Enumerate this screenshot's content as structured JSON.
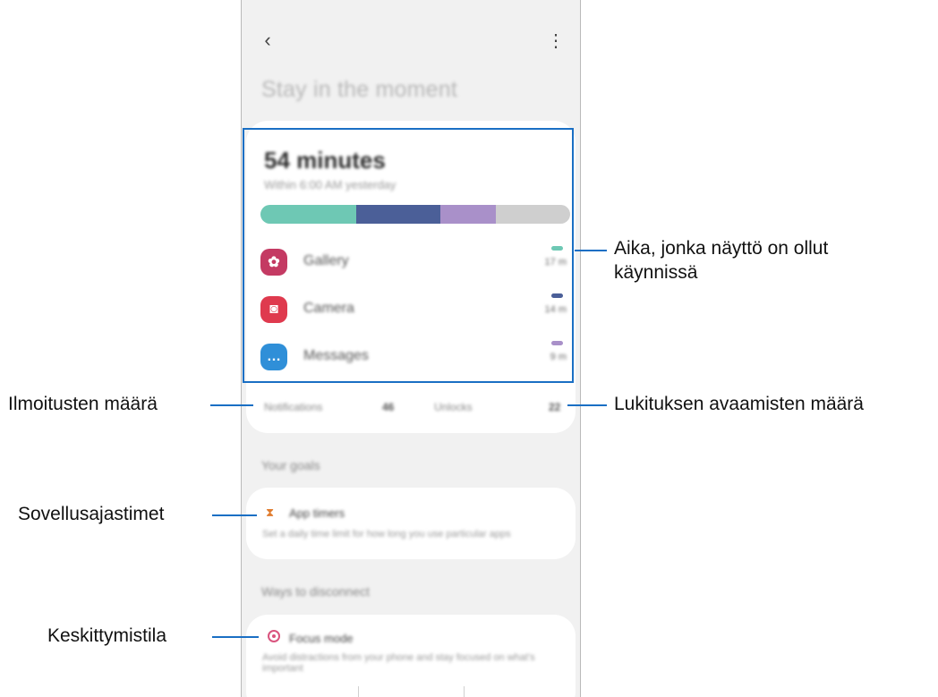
{
  "header": {
    "back_icon": "chevron-left-icon",
    "more_icon": "more-vertical-icon"
  },
  "page": {
    "title": "Stay in the moment"
  },
  "usage": {
    "screen_time": "54 minutes",
    "subtitle": "Within 6:00 AM yesterday",
    "bar": [
      {
        "color": "#6ec8b4",
        "fraction": 0.31
      },
      {
        "color": "#4b5f98",
        "fraction": 0.27
      },
      {
        "color": "#a990c9",
        "fraction": 0.18
      },
      {
        "color": "#cfcfcf",
        "fraction": 0.24
      }
    ],
    "apps": [
      {
        "name": "Gallery",
        "time": "17 m",
        "icon_color": "#c43a63",
        "mark_color": "#6ec8b4",
        "icon": "gallery-icon"
      },
      {
        "name": "Camera",
        "time": "14 m",
        "icon_color": "#df3a4e",
        "mark_color": "#4b5f98",
        "icon": "camera-icon"
      },
      {
        "name": "Messages",
        "time": "9 m",
        "icon_color": "#2f8fd8",
        "mark_color": "#a990c9",
        "icon": "messages-icon"
      }
    ],
    "notifications": {
      "label": "Notifications",
      "value": "46"
    },
    "unlocks": {
      "label": "Unlocks",
      "value": "22"
    }
  },
  "goals": {
    "header": "Your goals",
    "app_timers": {
      "title": "App timers",
      "desc": "Set a daily time limit for how long you use particular apps"
    }
  },
  "disconnect": {
    "header": "Ways to disconnect",
    "focus_mode": {
      "title": "Focus mode",
      "desc": "Avoid distractions from your phone and stay focused on what's important"
    }
  },
  "callouts": {
    "screen_time": "Aika, jonka näyttö on ollut\nkäynnissä",
    "notifications": "Ilmoitusten määrä",
    "unlocks": "Lukituksen avaamisten määrä",
    "app_timers": "Sovellusajastimet",
    "focus_mode": "Keskittymistila"
  },
  "colors": {
    "accent": "#1a6fc4",
    "background": "#f1f1f1"
  }
}
